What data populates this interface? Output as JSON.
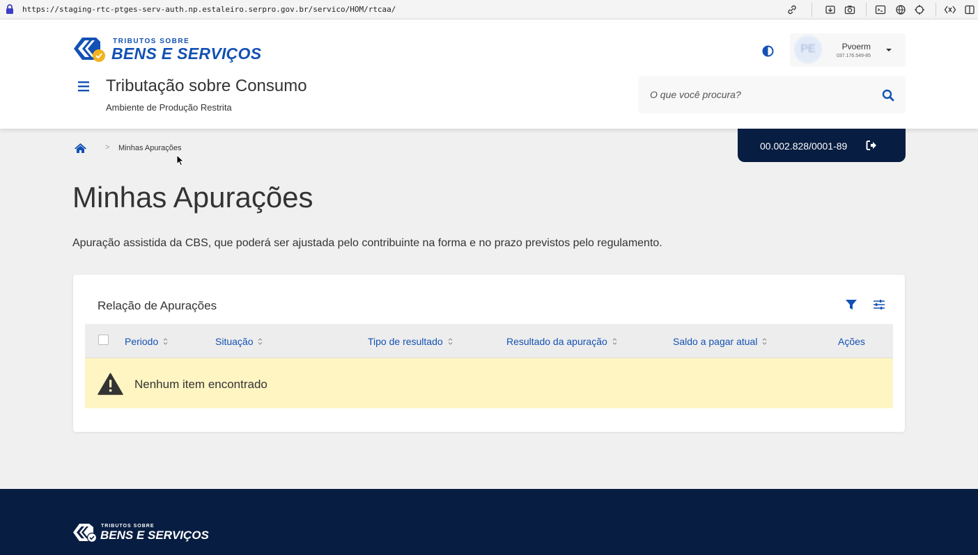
{
  "browser": {
    "url": "https://staging-rtc-ptges-serv-auth.np.estaleiro.serpro.gov.br/servico/HOM/rtcaa/",
    "icons": [
      "lock-icon",
      "link-icon",
      "download-icon",
      "camera-icon",
      "terminal-icon",
      "globe-icon",
      "crosshair-icon",
      "extension-icon",
      "sidebar-icon"
    ]
  },
  "brand": {
    "logo_small": "TRIBUTOS SOBRE",
    "logo_big": "BENS E SERVIÇOS",
    "primary_color": "#1351b4",
    "dark_color": "#071d41"
  },
  "header": {
    "system_title": "Tributação sobre Consumo",
    "system_subtitle": "Ambiente de Produção Restrita",
    "search_placeholder": "O que você procura?",
    "user": {
      "name": "Pvoerm",
      "cpf": "037.176.549-85",
      "avatar_initials": "PE"
    }
  },
  "company": {
    "cnpj": "00.002.828/0001-89"
  },
  "breadcrumb": {
    "current": "Minhas Apurações"
  },
  "page": {
    "title": "Minhas Apurações",
    "description": "Apuração assistida da CBS, que poderá ser ajustada pelo contribuinte na forma e no prazo previstos pelo regulamento."
  },
  "table": {
    "title": "Relação de Apurações",
    "columns": [
      "Periodo",
      "Situação",
      "Tipo de resultado",
      "Resultado da apuração",
      "Saldo a pagar atual",
      "Ações"
    ],
    "rows": [],
    "empty_message": "Nenhum item encontrado",
    "empty_bg_color": "#fff5c2"
  },
  "footer": {
    "logo_small": "TRIBUTOS SOBRE",
    "logo_big": "BENS E SERVIÇOS"
  }
}
